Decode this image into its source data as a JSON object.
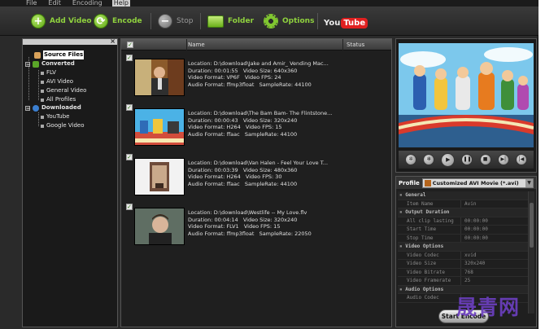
{
  "menu": [
    "File",
    "Edit",
    "Encoding",
    "Help"
  ],
  "toolbar": {
    "add_video": "Add Video",
    "encode": "Encode",
    "stop": "Stop",
    "folder": "Folder",
    "options": "Options",
    "youtube_you": "You",
    "youtube_tube": "Tube"
  },
  "tree": {
    "source_files": "Source Files",
    "converted": "Converted",
    "flv": "FLV",
    "avi_video": "AVI Video",
    "general_video": "General Video",
    "all_profiles": "All Profiles",
    "downloaded": "Downloaded",
    "youtube": "YouTube",
    "google_video": "Google Video"
  },
  "list": {
    "columns": {
      "name": "Name",
      "status": "Status"
    },
    "items": [
      {
        "location": "Location: D:\\download\\Jake and Amir_ Vending Mac...",
        "duration": "Duration: 00:01:55   Video Size: 640x360",
        "video": "Video Format: VP6F   Video FPS: 24",
        "audio": "Audio Format: ffmp3float   SampleRate: 44100"
      },
      {
        "location": "Location: D:\\download\\The Bam Bam- The Flintstone...",
        "duration": "Duration: 00:00:43   Video Size: 320x240",
        "video": "Video Format: H264   Video FPS: 15",
        "audio": "Audio Format: ffaac   SampleRate: 44100"
      },
      {
        "location": "Location: D:\\download\\Van Halen - Feel Your Love T...",
        "duration": "Duration: 00:03:39   Video Size: 480x360",
        "video": "Video Format: H264   Video FPS: 30",
        "audio": "Audio Format: ffaac   SampleRate: 44100"
      },
      {
        "location": "Location: D:\\download\\Westlife -- My Love.flv",
        "duration": "Duration: 00:04:14   Video Size: 320x240",
        "video": "Video Format: FLV1   Video FPS: 15",
        "audio": "Audio Format: ffmp3float   SampleRate: 22050"
      }
    ]
  },
  "profile": {
    "label": "Profile",
    "selected": "Customized AVI Movie (*.avi)",
    "props": [
      {
        "k": "General",
        "section": true
      },
      {
        "k": "Item Name",
        "v": "Avin"
      },
      {
        "k": "Output Duration",
        "section": true
      },
      {
        "k": "All clip lasting",
        "v": "00:00:00"
      },
      {
        "k": "Start Time",
        "v": "00:00:00"
      },
      {
        "k": "Stop Time",
        "v": "00:00:00"
      },
      {
        "k": "Video Options",
        "section": true
      },
      {
        "k": "Video Codec",
        "v": "xvid"
      },
      {
        "k": "Video Size",
        "v": "320x240"
      },
      {
        "k": "Video Bitrate",
        "v": "768"
      },
      {
        "k": "Video Framerate",
        "v": "25"
      },
      {
        "k": "Audio Options",
        "section": true
      },
      {
        "k": "Audio Codec",
        "v": ""
      }
    ],
    "start_encode": "Start Encode"
  },
  "watermark": "晟青网",
  "colors": {
    "accent_green": "#8fd13e",
    "panel_dark": "#1f1f1f",
    "youtube_red": "#e02020"
  }
}
